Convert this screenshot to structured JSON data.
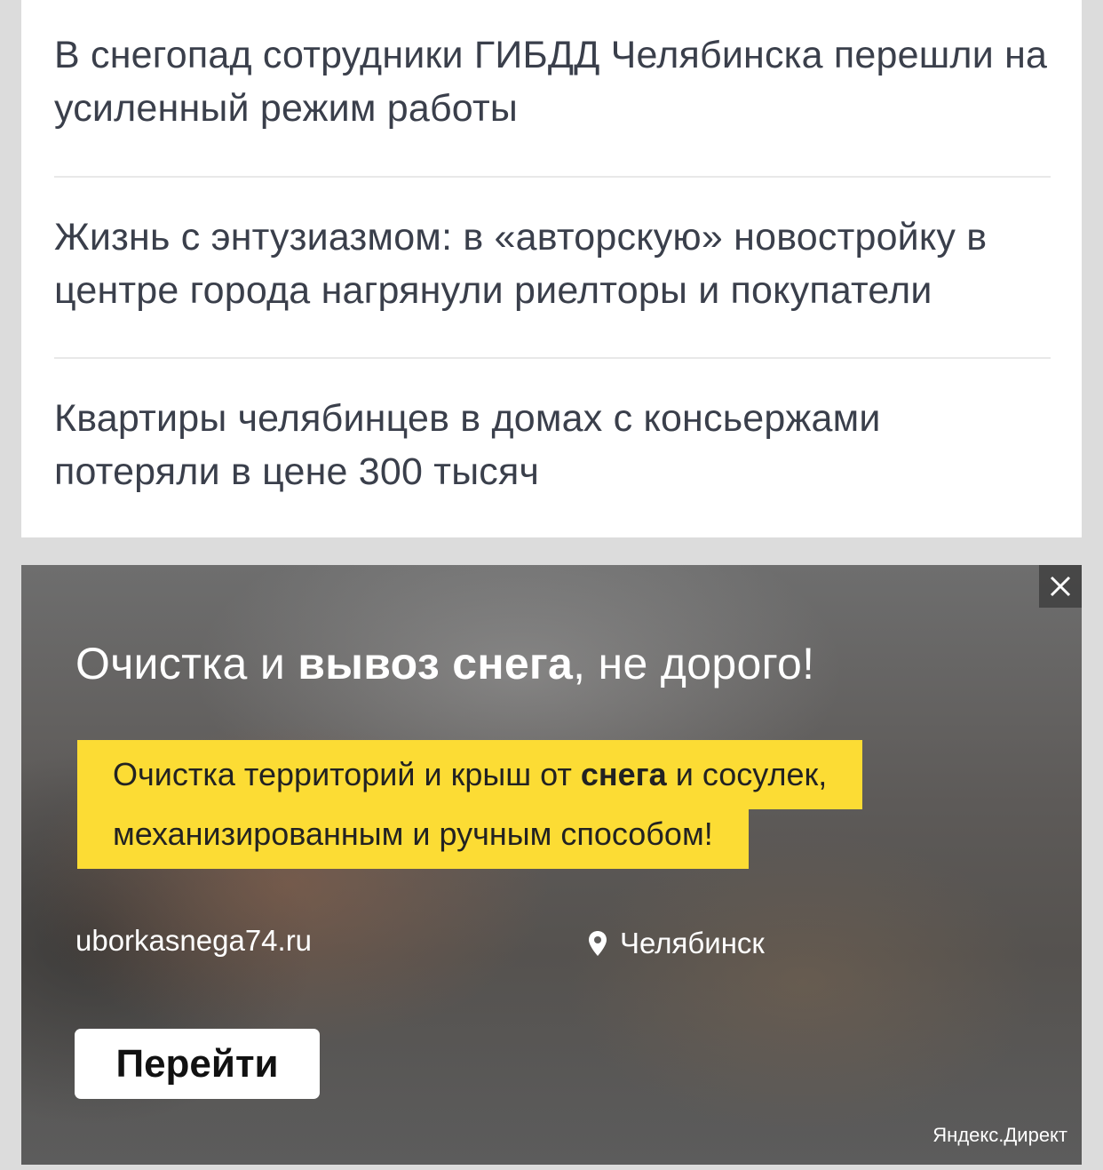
{
  "news": [
    {
      "title": "В снегопад сотрудники ГИБДД Челябинска перешли на усиленный режим работы"
    },
    {
      "title": "Жизнь с энтузиазмом: в «авторскую» новостройку в центре города нагрянули риелторы и покупатели"
    },
    {
      "title": "Квартиры челябинцев в домах с консьержами потеряли в цене 300 тысяч"
    }
  ],
  "ad": {
    "title_part1": "Очистка и ",
    "title_bold": "вывоз снега",
    "title_part2": ", не дорого!",
    "text_line1_part1": "Очистка территорий и крыш от ",
    "text_line1_bold": "снега",
    "text_line1_part2": " и сосулек,",
    "text_line2": "механизированным и ручным способом!",
    "domain": "uborkasnega74.ru",
    "region": "Челябинск",
    "button_label": "Перейти",
    "source": "Яндекс.Директ",
    "highlight_color": "#fcdc34"
  },
  "icons": {
    "close": "close-icon",
    "location": "location-pin-icon"
  }
}
